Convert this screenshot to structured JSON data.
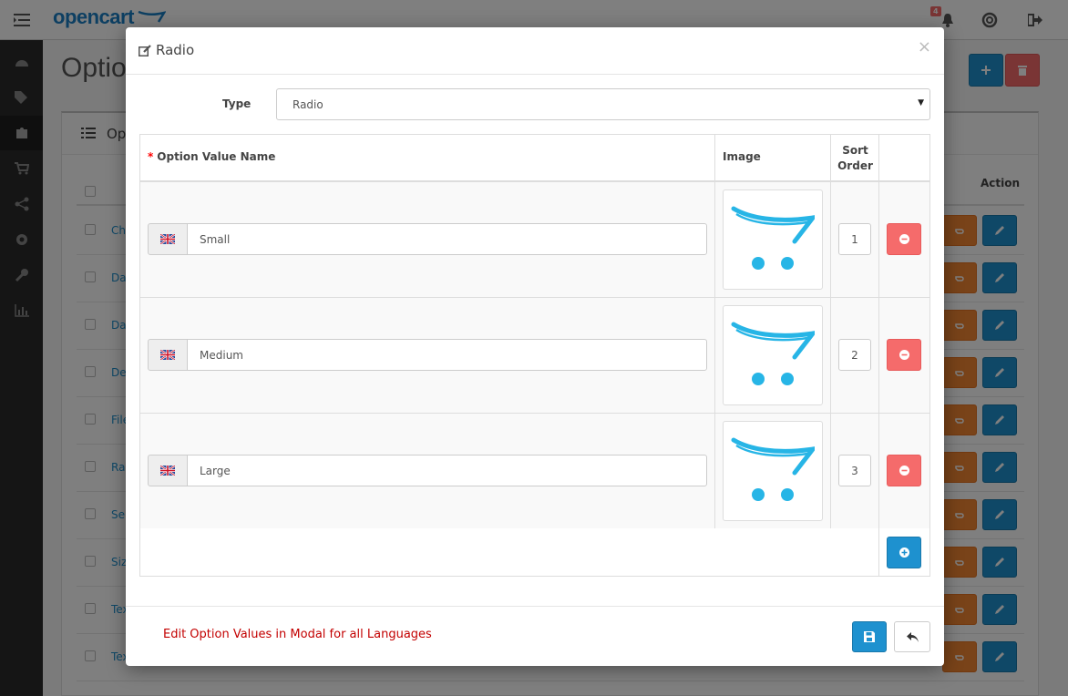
{
  "app": {
    "logo": "opencart",
    "notification_count": "4"
  },
  "background": {
    "page_heading": "Option",
    "panel_title": "Option List",
    "action_header": "Action",
    "rows": [
      "Checkbox",
      "Date",
      "Date & Time",
      "Delivery Date",
      "File",
      "Radio",
      "Select",
      "Size",
      "Text",
      "Textarea"
    ]
  },
  "modal": {
    "title": "Radio",
    "close_label": "×",
    "type_label": "Type",
    "type_value": "Radio",
    "columns": {
      "name": "Option Value Name",
      "image": "Image",
      "sort_order_1": "Sort",
      "sort_order_2": "Order"
    },
    "values": [
      {
        "name": "Small",
        "sort_order": "1"
      },
      {
        "name": "Medium",
        "sort_order": "2"
      },
      {
        "name": "Large",
        "sort_order": "3"
      }
    ],
    "footer_note": "Edit Option Values in Modal for all Languages"
  },
  "colors": {
    "primary": "#1e91cf",
    "danger": "#f56b6b",
    "warning": "#f38733",
    "sidebar": "#2a2a2a"
  },
  "icons": {
    "title": "edit-icon",
    "language": "uk-flag-icon",
    "image": "opencart-cart-logo-icon",
    "remove": "minus-circle-icon",
    "add": "plus-circle-icon",
    "save": "save-icon",
    "back": "reply-icon"
  }
}
